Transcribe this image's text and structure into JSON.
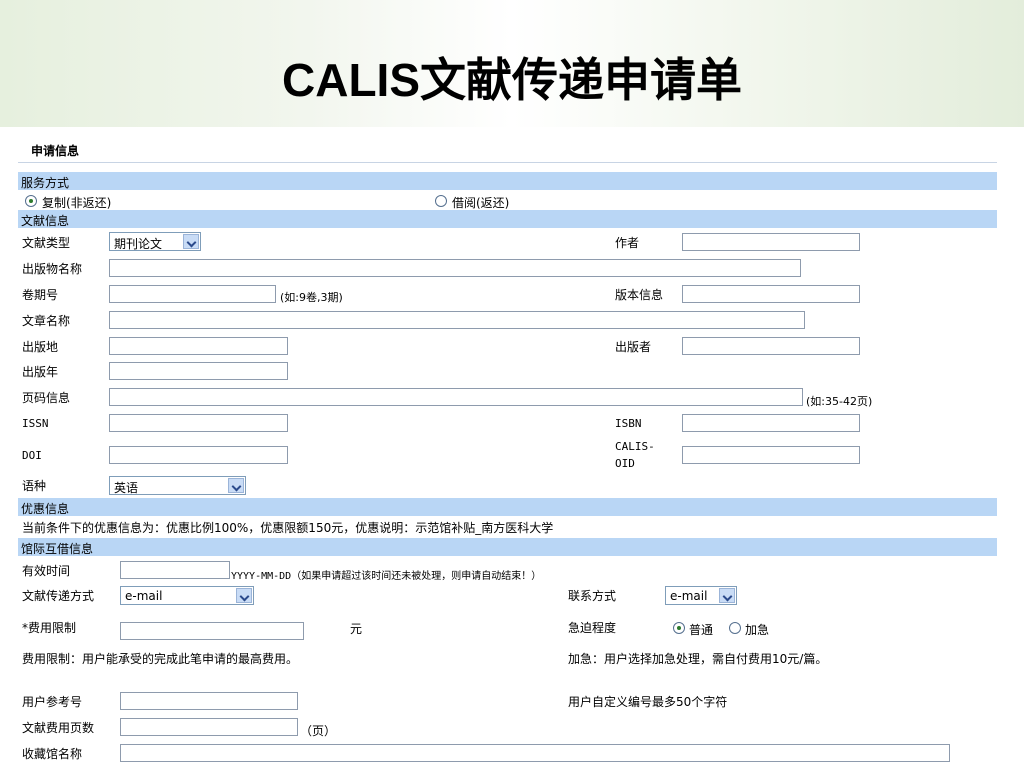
{
  "title": "CALIS文献传递申请单",
  "app_info": {
    "header": "申请信息"
  },
  "service": {
    "section": "服务方式",
    "opt_copy": "复制(非返还)",
    "opt_borrow": "借阅(返还)"
  },
  "doc": {
    "section": "文献信息",
    "type_label": "文献类型",
    "type_value": "期刊论文",
    "author_label": "作者",
    "pub_name_label": "出版物名称",
    "volume_label": "卷期号",
    "volume_hint": "(如:9卷,3期)",
    "edition_label": "版本信息",
    "article_label": "文章名称",
    "place_label": "出版地",
    "publisher_label": "出版者",
    "year_label": "出版年",
    "pages_label": "页码信息",
    "pages_hint": "(如:35-42页)",
    "issn_label": "ISSN",
    "isbn_label": "ISBN",
    "doi_label": "DOI",
    "calis_oid_label_1": "CALIS-",
    "calis_oid_label_2": "OID",
    "lang_label": "语种",
    "lang_value": "英语"
  },
  "discount": {
    "section": "优惠信息",
    "text": "当前条件下的优惠信息为：优惠比例100%，优惠限额150元，优惠说明：示范馆补贴_南方医科大学"
  },
  "ill": {
    "section": "馆际互借信息",
    "valid_label": "有效时间",
    "valid_hint": "YYYY-MM-DD（如果申请超过该时间还未被处理，则申请自动结束！）",
    "delivery_label": "文献传递方式",
    "delivery_value": "e-mail",
    "contact_label": "联系方式",
    "contact_value": "e-mail",
    "fee_label": "*费用限制",
    "fee_unit": "元",
    "urgency_label": "急迫程度",
    "urgency_normal": "普通",
    "urgency_urgent": "加急",
    "fee_note": "费用限制：用户能承受的完成此笔申请的最高费用。",
    "urgent_note": "加急：用户选择加急处理，需自付费用10元/篇。",
    "ref_label": "用户参考号",
    "ref_note": "用户自定义编号最多50个字符",
    "fee_pages_label": "文献费用页数",
    "fee_pages_unit": "（页）",
    "holding_lib_label": "收藏馆名称"
  }
}
